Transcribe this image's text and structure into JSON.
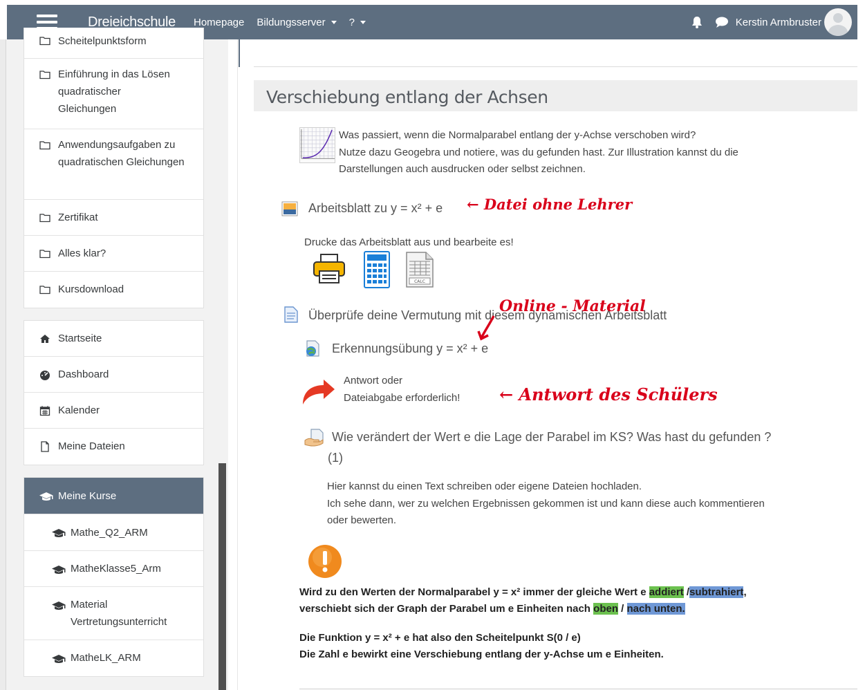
{
  "navbar": {
    "brand": "Dreieichschule",
    "links": [
      "Homepage",
      "Bildungsserver",
      "?"
    ],
    "user_name": "Kerstin Armbruster"
  },
  "sidebar": {
    "top_items": [
      "Scheitelpunktsform",
      "Einführung in das Lösen quadratischer Gleichungen",
      "Anwendungsaufgaben zu quadratischen Gleichungen",
      "Zertifikat",
      "Alles klar?",
      "Kursdownload"
    ],
    "main_nav": [
      "Startseite",
      "Dashboard",
      "Kalender",
      "Meine Dateien"
    ],
    "courses_header": "Meine Kurse",
    "courses": [
      "Mathe_Q2_ARM",
      "MatheKlasse5_Arm",
      "Material Vertretungsunterricht",
      "MatheLK_ARM"
    ]
  },
  "main": {
    "section_title": "Verschiebung entlang der Achsen",
    "intro_lines": [
      "Was passiert, wenn die Normalparabel entlang der y-Achse verschoben wird?",
      "Nutze dazu Geogebra und notiere, was du gefunden hast. Zur Illustration kannst du die",
      "Darstellungen auch ausdrucken oder selbst zeichnen."
    ],
    "worksheet_title": "Arbeitsblatt zu y = x² + e",
    "annotation_1": "← Datei ohne Lehrer",
    "worksheet_desc": "Drucke das Arbeitsblatt aus und bearbeite es!",
    "check_title": "Überprüfe deine Vermutung mit diesem dynamischen Arbeitsblatt",
    "annotation_2": "Online - Material",
    "exercise_title": "Erkennungsübung y = x² + e",
    "answer_line1": "Antwort oder",
    "answer_line2": "Dateiabgabe erforderlich!",
    "annotation_3": "← Antwort des Schülers",
    "assign_title": "Wie verändert der Wert e die Lage der Parabel im KS? Was hast du gefunden ?",
    "assign_count": "(1)",
    "assign_desc_lines": [
      "Hier kannst du einen Text schreiben oder eigene Dateien hochladen.",
      "Ich sehe dann, wer zu welchen Ergebnissen gekommen ist und kann diese auch kommentieren",
      "oder bewerten."
    ],
    "conclusion": {
      "l1_a": "Wird zu den Werten der Normalparabel y = x² immer der gleiche Wert e ",
      "l1_hl1": "addiert",
      "l1_sep": " /",
      "l1_hl2": "subtrahiert",
      "l1_end": ",",
      "l2_a": "verschiebt sich der Graph der Parabel um e Einheiten  nach ",
      "l2_hl1": "oben",
      "l2_sep": " / ",
      "l2_hl2": "nach unten.",
      "l3": "Die Funktion y = x² + e  hat also den Scheitelpunkt S(0 / e)",
      "l4": "Die Zahl e bewirkt eine Verschiebung entlang der y-Achse um e Einheiten."
    }
  },
  "colors": {
    "navbar": "#5d6e80",
    "highlight_green": "#6cc14f",
    "highlight_blue": "#6f98d6",
    "annotation_red": "#d9001a"
  }
}
